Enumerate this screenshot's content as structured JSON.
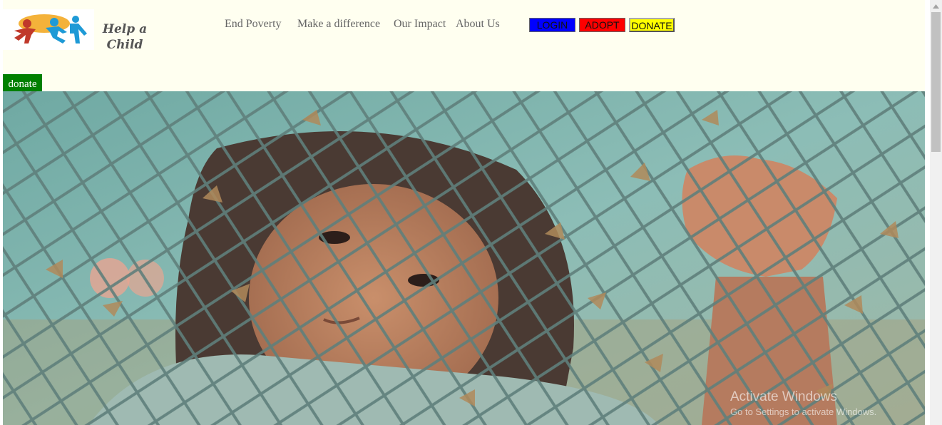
{
  "logo": {
    "text": "Help a Child",
    "icon": "children-holding-hands-logo"
  },
  "nav": {
    "items": [
      {
        "label": "End Poverty"
      },
      {
        "label": "Make a difference"
      },
      {
        "label": "Our Impact"
      },
      {
        "label": "About Us"
      }
    ]
  },
  "buttons": {
    "login": "LOGIN",
    "adopt": "ADOPT",
    "donate": "DONATE"
  },
  "donate_tag": "donate",
  "hero": {
    "image": "girl-behind-chain-link-fence-photo"
  },
  "watermark": {
    "title": "Activate Windows",
    "subtitle": "Go to Settings to activate Windows."
  },
  "colors": {
    "page_bg": "#fffff0",
    "login": "#0000ff",
    "adopt": "#ff0000",
    "donate": "#ffff00",
    "donate_tag": "#008000"
  }
}
